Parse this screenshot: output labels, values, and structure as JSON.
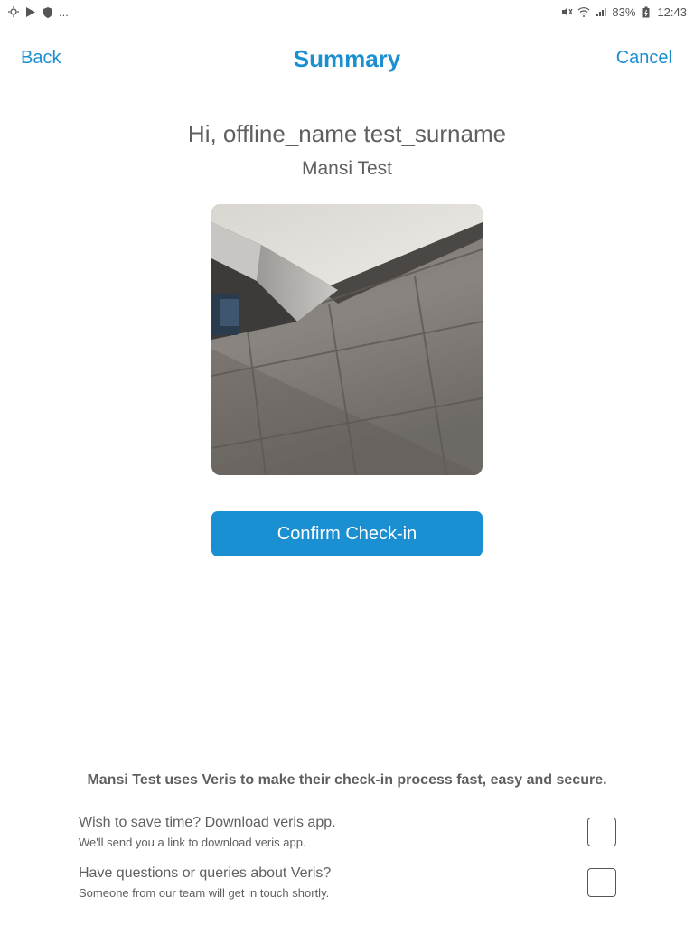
{
  "status_bar": {
    "left_ellipsis": "...",
    "battery": "83%",
    "time": "12:43"
  },
  "nav": {
    "back_label": "Back",
    "title": "Summary",
    "cancel_label": "Cancel"
  },
  "greeting": "Hi, offline_name  test_surname",
  "company": "Mansi Test",
  "confirm_label": "Confirm Check-in",
  "veris_info": "Mansi Test uses Veris to make their check-in process fast, easy and secure.",
  "options": [
    {
      "title": "Wish to save time? Download veris app.",
      "subtitle": "We'll send you a link to download veris app.",
      "checked": false
    },
    {
      "title": "Have questions or queries about Veris?",
      "subtitle": "Someone from our team will get in touch shortly.",
      "checked": false
    }
  ],
  "colors": {
    "accent": "#1a8fd1",
    "text": "#5f5f5f"
  },
  "icons": {
    "status_left": [
      "weather-icon",
      "play-store-icon",
      "shield-icon"
    ],
    "status_right": [
      "mute-icon",
      "wifi-icon",
      "signal-icon",
      "battery-icon"
    ]
  }
}
